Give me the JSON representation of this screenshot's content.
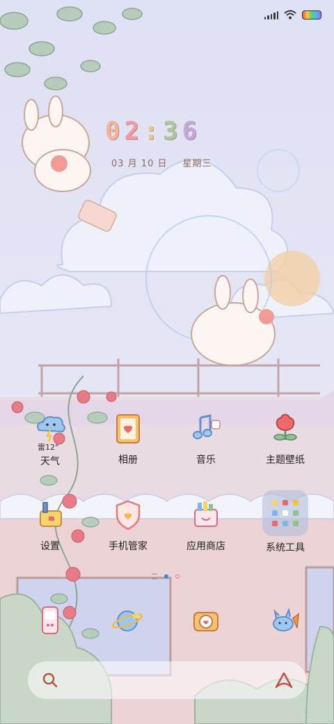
{
  "status_bar": {
    "signal_icon": "signal-icon",
    "wifi_icon": "wifi-icon",
    "battery_icon": "battery-icon"
  },
  "clock": {
    "digits": [
      "0",
      "2",
      ":",
      "3",
      "6"
    ]
  },
  "date": {
    "month_day": "03 月 10 日",
    "weekday": "星期三"
  },
  "weather_widget": {
    "temperature": "12°",
    "condition_char": "雷"
  },
  "apps_row1": [
    {
      "label": "天气",
      "icon": "weather-icon"
    },
    {
      "label": "相册",
      "icon": "album-icon"
    },
    {
      "label": "音乐",
      "icon": "music-icon"
    },
    {
      "label": "主题壁纸",
      "icon": "theme-icon"
    }
  ],
  "apps_row2": [
    {
      "label": "设置",
      "icon": "settings-icon"
    },
    {
      "label": "手机管家",
      "icon": "security-icon"
    },
    {
      "label": "应用商店",
      "icon": "store-icon"
    },
    {
      "label": "系统工具",
      "icon": "folder-icon"
    }
  ],
  "dock": [
    {
      "icon": "phone-icon"
    },
    {
      "icon": "browser-icon"
    },
    {
      "icon": "camera-icon"
    },
    {
      "icon": "messages-icon"
    }
  ],
  "page_indicator": {
    "pages": 2,
    "current": 1
  },
  "search_bar": {
    "search_icon": "search-icon",
    "assistant_icon": "assistant-icon"
  },
  "colors": {
    "accent_dot": "#3d8bd9",
    "inactive_dot": "#e07a7a"
  }
}
